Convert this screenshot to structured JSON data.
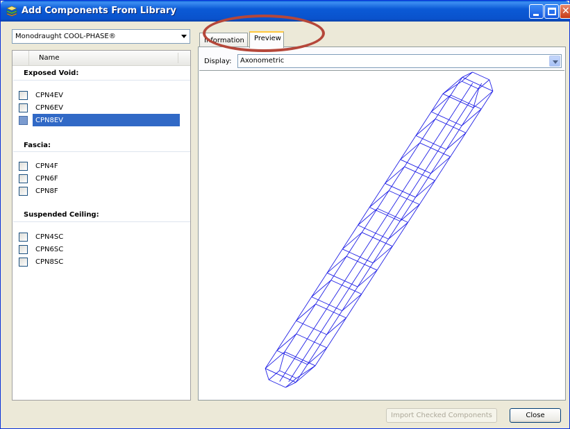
{
  "window": {
    "title": "Add Components From Library"
  },
  "library_select": {
    "value": "Monodraught COOL-PHASE®"
  },
  "tree": {
    "column_header": "Name",
    "groups": [
      {
        "title": "Exposed Void:",
        "items": [
          {
            "label": "CPN4EV",
            "checked": false,
            "selected": false
          },
          {
            "label": "CPN6EV",
            "checked": false,
            "selected": false
          },
          {
            "label": "CPN8EV",
            "checked": false,
            "selected": true
          }
        ]
      },
      {
        "title": "Fascia:",
        "items": [
          {
            "label": "CPN4F",
            "checked": false,
            "selected": false
          },
          {
            "label": "CPN6F",
            "checked": false,
            "selected": false
          },
          {
            "label": "CPN8F",
            "checked": false,
            "selected": false
          }
        ]
      },
      {
        "title": "Suspended Ceiling:",
        "items": [
          {
            "label": "CPN4SC",
            "checked": false,
            "selected": false
          },
          {
            "label": "CPN6SC",
            "checked": false,
            "selected": false
          },
          {
            "label": "CPN8SC",
            "checked": false,
            "selected": false
          }
        ]
      }
    ]
  },
  "tabs": {
    "information": "Information",
    "preview": "Preview",
    "active": "preview"
  },
  "preview": {
    "display_label": "Display:",
    "display_value": "Axonometric"
  },
  "buttons": {
    "import": "Import Checked Components",
    "close": "Close"
  },
  "colors": {
    "wireframe": "#1f1fe6",
    "selection": "#3169c6",
    "highlight_ellipse": "#b5473a"
  }
}
